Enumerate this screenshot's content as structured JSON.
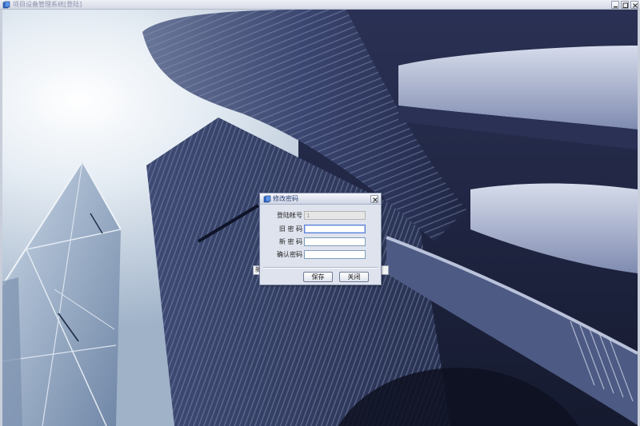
{
  "window": {
    "title": "项目设备管理系统[登陆]"
  },
  "background": {
    "partial_field_text": "新"
  },
  "dialog": {
    "title": "修改密码",
    "fields": [
      {
        "label": "登陆帐号",
        "value": "1",
        "readonly": true
      },
      {
        "label": "旧 密 码",
        "value": "",
        "readonly": false
      },
      {
        "label": "新 密 码",
        "value": "",
        "readonly": false
      },
      {
        "label": "确认密码",
        "value": "",
        "readonly": false
      }
    ],
    "save_label": "保存",
    "close_label": "关闭"
  },
  "colors": {
    "title_text": "#8a93ab",
    "dialog_title_text": "#2a3e75",
    "input_border": "#7f9db9"
  },
  "icons": {
    "app": "window-app-icon",
    "dialog": "dialog-app-icon"
  }
}
